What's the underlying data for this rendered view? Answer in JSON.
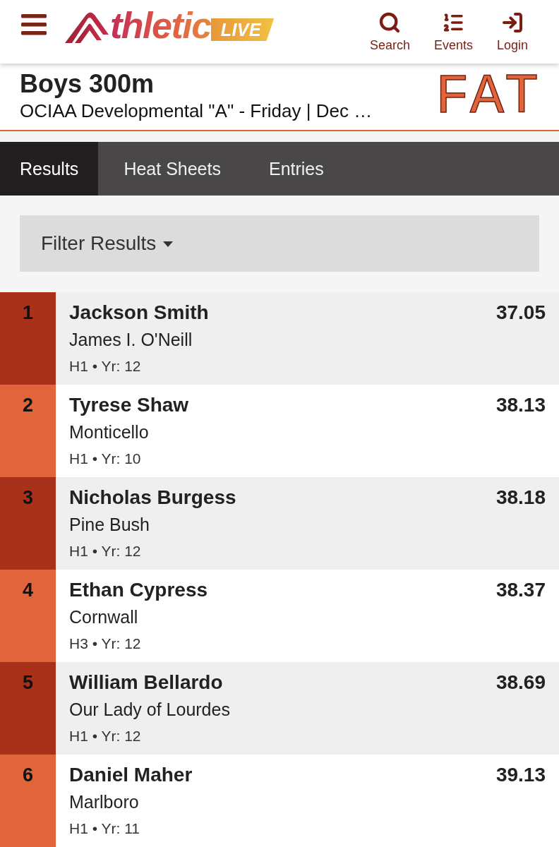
{
  "header": {
    "logo": {
      "wordmark": "thletic",
      "badge": "LIVE"
    },
    "nav": [
      {
        "kind": "search",
        "label": "Search"
      },
      {
        "kind": "events",
        "label": "Events"
      },
      {
        "kind": "login",
        "label": "Login"
      }
    ]
  },
  "event": {
    "title": "Boys 300m",
    "subtitle": "OCIAA Developmental \"A\" - Friday | Dec …",
    "timing": "FAT"
  },
  "tabs": [
    {
      "label": "Results",
      "selected": true
    },
    {
      "label": "Heat Sheets",
      "selected": false
    },
    {
      "label": "Entries",
      "selected": false
    }
  ],
  "filter": {
    "label": "Filter Results"
  },
  "results": [
    {
      "place": "1",
      "name": "Jackson Smith",
      "school": "James I. O'Neill",
      "details": "H1 • Yr: 12",
      "time": "37.05"
    },
    {
      "place": "2",
      "name": "Tyrese Shaw",
      "school": "Monticello",
      "details": "H1 • Yr: 10",
      "time": "38.13"
    },
    {
      "place": "3",
      "name": "Nicholas Burgess",
      "school": "Pine Bush",
      "details": "H1 • Yr: 12",
      "time": "38.18"
    },
    {
      "place": "4",
      "name": "Ethan Cypress",
      "school": "Cornwall",
      "details": "H3 • Yr: 12",
      "time": "38.37"
    },
    {
      "place": "5",
      "name": "William Bellardo",
      "school": "Our Lady of Lourdes",
      "details": "H1 • Yr: 12",
      "time": "38.69"
    },
    {
      "place": "6",
      "name": "Daniel Maher",
      "school": "Marlboro",
      "details": "H1 • Yr: 11",
      "time": "39.13"
    }
  ]
}
